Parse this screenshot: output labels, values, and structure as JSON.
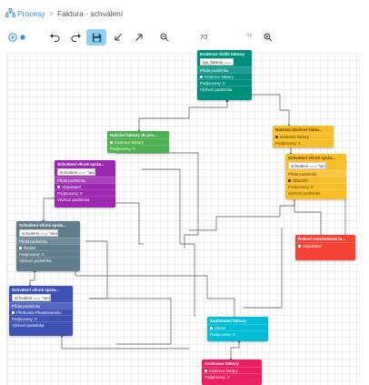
{
  "breadcrumb": {
    "root": "Procesy",
    "separator": ">",
    "current": "Faktura - schválení"
  },
  "toolbar": {
    "zoom_value": "70",
    "zoom_unit": "%"
  },
  "nodes": {
    "evidence": {
      "title": "Evidence došlé faktury",
      "condition": "typ_faktury === \"zboží\"",
      "row1": "Přidat podmínku",
      "row2": "Evidence faktury",
      "row3": "Podprocesy: 0",
      "row4": "Výchozí podmínka"
    },
    "nahrani_dopln": {
      "title": "Nahrání faktury do pro...",
      "row1": "Evidence faktury",
      "row2": "Podprocesy: 0"
    },
    "nahrani_zbozi": {
      "title": "Nahrání zbožové faktu...",
      "row1": "Evidence faktury",
      "row2": "Podprocesy: 0"
    },
    "schvaleni_purple": {
      "title": "Schválení věcné správ...",
      "condition": "schvaleni === \"ano\"",
      "row1": "Přidat podmínku",
      "row2": "Objednatel",
      "row3": "Podprocesy: 0",
      "row4": "Výchozí podmínka"
    },
    "schvaleni_yellow": {
      "title": "Schválení věcné správ...",
      "condition": "schvaleni === \"ano\"",
      "row1": "Přidat podmínku",
      "row2": "Skladník",
      "row3": "Podprocesy: 0",
      "row4": "Výchozí podmínka"
    },
    "schvaleni_gray": {
      "title": "Schválení věcné správ...",
      "condition": "schvaleni === \"ano\"",
      "row1": "Přidat podmínku",
      "row2": "Ředitel",
      "row3": "Podprocesy: 0",
      "row4": "Výchozí podmínka"
    },
    "reseni": {
      "title": "Řešení neschválené fa...",
      "row1": "Objednatel"
    },
    "schvaleni_blue": {
      "title": "Schválení věcné správ...",
      "condition": "schvaleni === \"ano\"",
      "row1": "Přidat podmínku",
      "row2": "Přednosta Představeného",
      "row3": "Podprocesy: 0",
      "row4": "Výchozí podmínka"
    },
    "zauctovani": {
      "title": "Zaúčtování faktury",
      "row1": "Účetní",
      "row2": "Podprocesy: 0"
    },
    "archivace": {
      "title": "Archivace faktury",
      "row1": "Evidence faktury",
      "row2": "Podprocesy: 0"
    }
  },
  "colors": {
    "teal": "#008f7e",
    "green": "#4caf50",
    "yellow": "#f9bd2a",
    "purple": "#9c27b0",
    "slate": "#607d8b",
    "red": "#f44336",
    "indigo": "#3f51b5",
    "cyan": "#00bcd4",
    "pink": "#e91e63",
    "accent": "#2f8fd8"
  }
}
